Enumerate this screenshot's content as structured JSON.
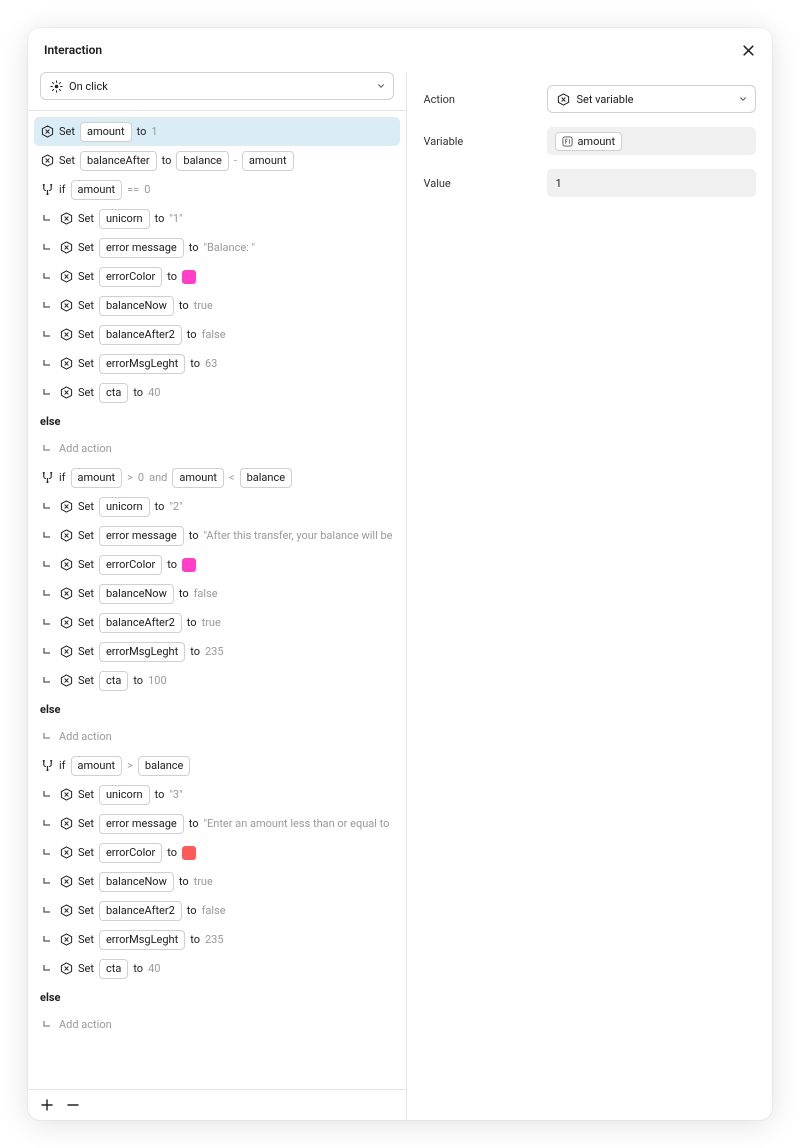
{
  "title": "Interaction",
  "trigger": {
    "label": "On click"
  },
  "footer": {
    "add": "+",
    "remove": "−"
  },
  "right": {
    "action": {
      "label": "Action",
      "value": "Set variable"
    },
    "variable": {
      "label": "Variable",
      "value": "amount"
    },
    "value": {
      "label": "Value",
      "value": "1"
    }
  },
  "els": {
    "else": "else",
    "addAction": "Add action"
  },
  "kw": {
    "set": "Set",
    "to": "to",
    "if": "if",
    "eq": "==",
    "gt": ">",
    "lt": "<",
    "and": "and",
    "minus": "-"
  },
  "vars": {
    "amount": "amount",
    "balanceAfter": "balanceAfter",
    "balance": "balance",
    "unicorn": "unicorn",
    "errorMessage": "error message",
    "errorColor": "errorColor",
    "balanceNow": "balanceNow",
    "balanceAfter2": "balanceAfter2",
    "errorMsgLeght": "errorMsgLeght",
    "cta": "cta"
  },
  "vals": {
    "one": "1",
    "zero": "0",
    "q1": "\"1\"",
    "q2": "\"2\"",
    "q3": "\"3\"",
    "balanceStr": "\"Balance: \"",
    "afterTransfer": "\"After this transfer, your balance will be",
    "enterAmount": "\"Enter an amount less than or equal to",
    "true": "true",
    "false": "false",
    "n63": "63",
    "n40": "40",
    "n235": "235",
    "n100": "100"
  },
  "colors": {
    "pink1": "#ff3ec9",
    "pink2": "#ff3ec9",
    "red": "#ff5a5a"
  }
}
